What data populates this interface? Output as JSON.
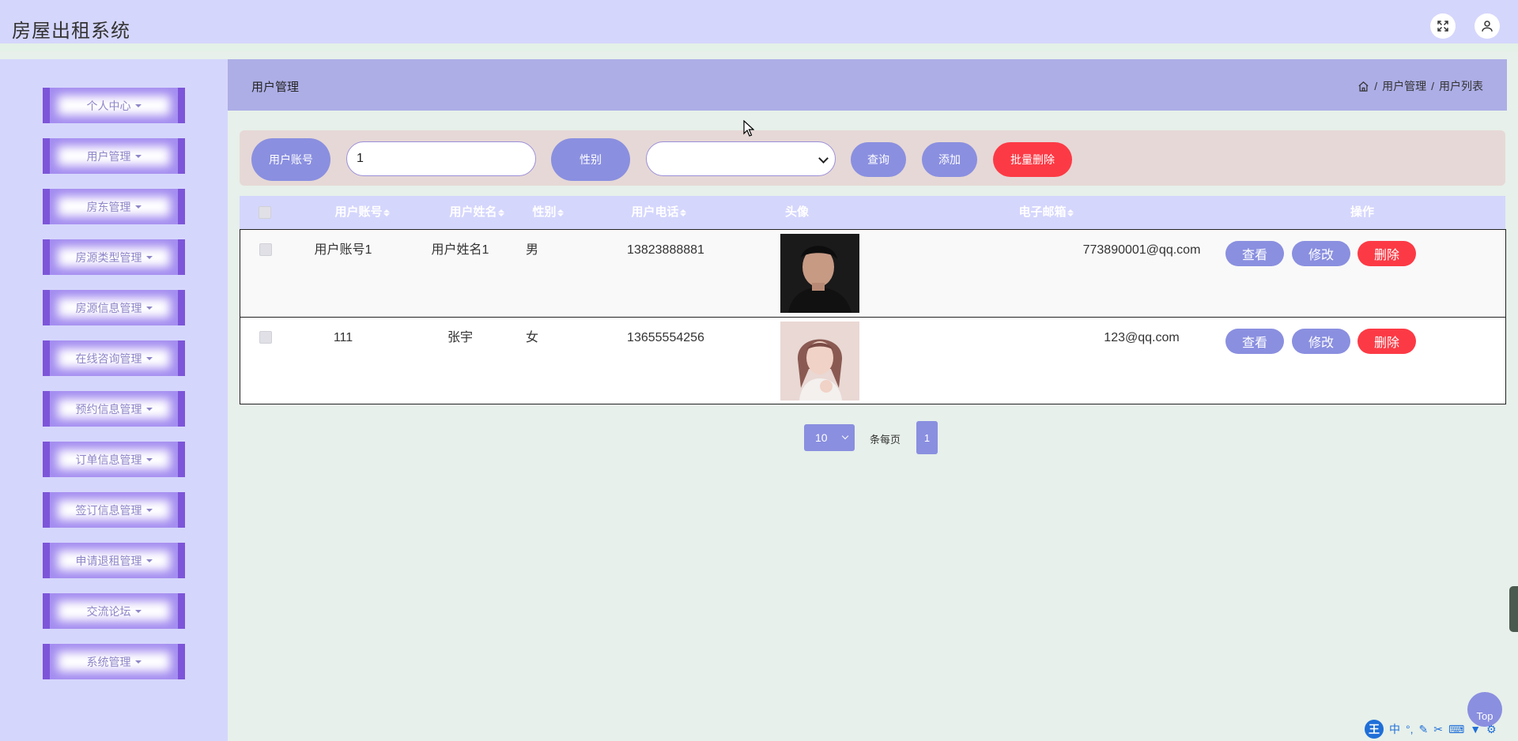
{
  "app": {
    "title": "房屋出租系统"
  },
  "header": {
    "fullscreen_icon": "expand-icon",
    "user_icon": "user-icon"
  },
  "sidebar": {
    "items": [
      {
        "label": "个人中心"
      },
      {
        "label": "用户管理"
      },
      {
        "label": "房东管理"
      },
      {
        "label": "房源类型管理"
      },
      {
        "label": "房源信息管理"
      },
      {
        "label": "在线咨询管理"
      },
      {
        "label": "预约信息管理"
      },
      {
        "label": "订单信息管理"
      },
      {
        "label": "签订信息管理"
      },
      {
        "label": "申请退租管理"
      },
      {
        "label": "交流论坛"
      },
      {
        "label": "系统管理"
      }
    ]
  },
  "breadcrumb": {
    "title": "用户管理",
    "path": [
      "用户管理",
      "用户列表"
    ],
    "separator": "/"
  },
  "search": {
    "account_label": "用户账号",
    "account_value": "1",
    "gender_label": "性别",
    "gender_value": "",
    "query_label": "查询",
    "add_label": "添加",
    "batch_delete_label": "批量删除"
  },
  "table": {
    "columns": [
      "用户账号",
      "用户姓名",
      "性别",
      "用户电话",
      "头像",
      "电子邮箱",
      "操作"
    ],
    "rows": [
      {
        "account": "用户账号1",
        "name": "用户姓名1",
        "gender": "男",
        "phone": "13823888881",
        "email": "773890001@qq.com"
      },
      {
        "account": "111",
        "name": "张宇",
        "gender": "女",
        "phone": "13655554256",
        "email": "123@qq.com"
      }
    ],
    "actions": {
      "view": "查看",
      "edit": "修改",
      "delete": "删除"
    }
  },
  "pagination": {
    "page_size": "10",
    "per_page_label": "条每页",
    "current_page": "1"
  },
  "misc": {
    "top_label": "Top",
    "ime_logo": "王",
    "ime_mode": "中"
  },
  "colors": {
    "accent": "#8a8fe0",
    "danger": "#fc3a45",
    "sidebar_bg": "#d5d6fc",
    "menu_border": "#7d55d9"
  }
}
